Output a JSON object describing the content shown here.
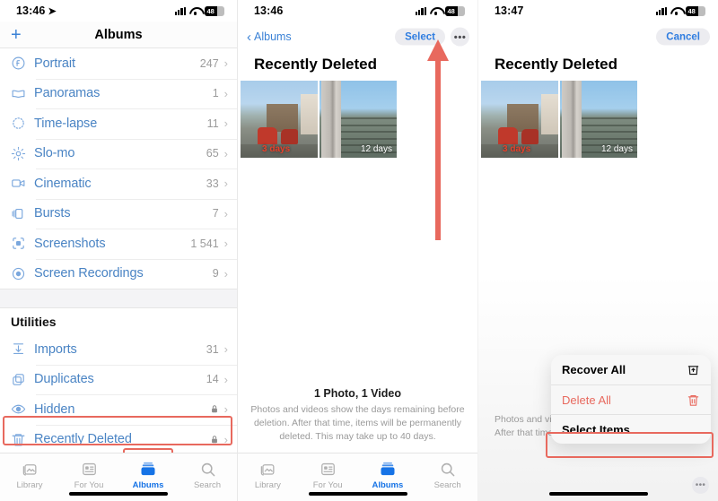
{
  "panels": {
    "albums": {
      "status": {
        "time": "13:46",
        "location_icon": "location-arrow-icon",
        "battery": "48"
      },
      "nav": {
        "add_label": "+",
        "title": "Albums"
      },
      "media_types": [
        {
          "icon": "portrait-icon",
          "label": "Portrait",
          "count": "247",
          "lock": false
        },
        {
          "icon": "panorama-icon",
          "label": "Panoramas",
          "count": "1",
          "lock": false
        },
        {
          "icon": "timelapse-icon",
          "label": "Time-lapse",
          "count": "11",
          "lock": false
        },
        {
          "icon": "slomo-icon",
          "label": "Slo-mo",
          "count": "65",
          "lock": false
        },
        {
          "icon": "cinematic-icon",
          "label": "Cinematic",
          "count": "33",
          "lock": false
        },
        {
          "icon": "bursts-icon",
          "label": "Bursts",
          "count": "7",
          "lock": false
        },
        {
          "icon": "screenshots-icon",
          "label": "Screenshots",
          "count": "1 541",
          "lock": false
        },
        {
          "icon": "screen-recordings-icon",
          "label": "Screen Recordings",
          "count": "9",
          "lock": false
        }
      ],
      "utilities_header": "Utilities",
      "utilities": [
        {
          "icon": "imports-icon",
          "label": "Imports",
          "count": "31",
          "lock": false
        },
        {
          "icon": "duplicates-icon",
          "label": "Duplicates",
          "count": "14",
          "lock": false
        },
        {
          "icon": "hidden-icon",
          "label": "Hidden",
          "count": "",
          "lock": true
        },
        {
          "icon": "trash-icon",
          "label": "Recently Deleted",
          "count": "",
          "lock": true
        }
      ],
      "tabs": [
        {
          "icon": "library-icon",
          "label": "Library",
          "active": false
        },
        {
          "icon": "foryou-icon",
          "label": "For You",
          "active": false
        },
        {
          "icon": "albums-icon",
          "label": "Albums",
          "active": true
        },
        {
          "icon": "search-icon",
          "label": "Search",
          "active": false
        }
      ]
    },
    "deleted": {
      "status": {
        "time": "13:46",
        "battery": "48"
      },
      "nav": {
        "back_label": "Albums",
        "select_label": "Select",
        "more_label": "•••"
      },
      "title": "Recently Deleted",
      "thumbnails": [
        {
          "name": "photo-street-scene",
          "day_label": "3 days",
          "day_label_style": "red"
        },
        {
          "name": "photo-fence",
          "day_label": "12 days",
          "day_label_style": "white"
        }
      ],
      "footer": {
        "count": "1 Photo, 1 Video",
        "description": "Photos and videos show the days remaining before deletion. After that time, items will be permanently deleted. This may take up to 40 days."
      },
      "tabs": [
        {
          "icon": "library-icon",
          "label": "Library",
          "active": false
        },
        {
          "icon": "foryou-icon",
          "label": "For You",
          "active": false
        },
        {
          "icon": "albums-icon",
          "label": "Albums",
          "active": true
        },
        {
          "icon": "search-icon",
          "label": "Search",
          "active": false
        }
      ]
    },
    "menu": {
      "status": {
        "time": "13:47",
        "battery": "48"
      },
      "nav": {
        "cancel_label": "Cancel"
      },
      "title": "Recently Deleted",
      "thumbnails": [
        {
          "name": "photo-street-scene",
          "day_label": "3 days",
          "day_label_style": "red"
        },
        {
          "name": "photo-fence",
          "day_label": "12 days",
          "day_label_style": "white"
        }
      ],
      "footer": {
        "description_line1": "Photos and videos s",
        "description_line2": "After that time, item"
      },
      "context_menu": [
        {
          "label": "Recover All",
          "icon": "recover-trash-icon",
          "danger": false
        },
        {
          "label": "Delete All",
          "icon": "trash-icon",
          "danger": true
        },
        {
          "label": "Select Items",
          "icon": "",
          "danger": false
        }
      ],
      "dots_button": "•••"
    }
  },
  "annotations": {
    "accent_color": "#e8695e",
    "arrow_name": "red-arrow-pointing-to-select",
    "boxes": [
      "recently-deleted-row",
      "albums-tab",
      "delete-all-menu-item"
    ]
  }
}
